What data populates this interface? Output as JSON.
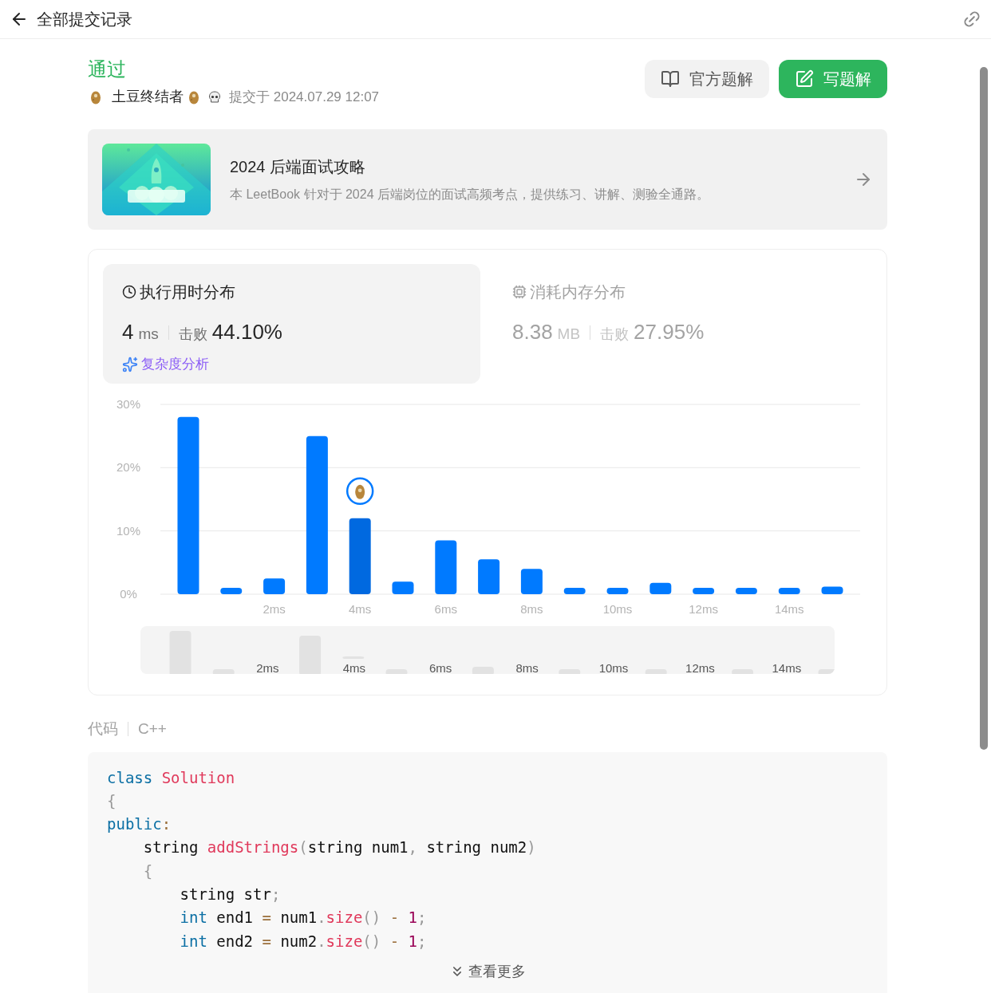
{
  "header": {
    "title": "全部提交记录"
  },
  "result": {
    "status": "通过",
    "user": "土豆终结者",
    "submitted": "提交于 2024.07.29 12:07"
  },
  "buttons": [
    {
      "label": "官方题解",
      "kind": "secondary"
    },
    {
      "label": "写题解",
      "kind": "primary"
    }
  ],
  "banner": {
    "title": "2024 后端面试攻略",
    "description": "本 LeetBook 针对于 2024 后端岗位的面试高频考点，提供练习、讲解、测验全通路。"
  },
  "stats": [
    {
      "title": "执行用时分布",
      "value": "4",
      "unit": "ms",
      "beat_label": "击败",
      "beat": "44.10%",
      "selected": true,
      "link": "复杂度分析"
    },
    {
      "title": "消耗内存分布",
      "value": "8.38",
      "unit": "MB",
      "beat_label": "击败",
      "beat": "27.95%",
      "selected": false
    }
  ],
  "chart_data": {
    "type": "bar",
    "x": [
      0,
      1,
      2,
      3,
      4,
      5,
      6,
      7,
      8,
      9,
      10,
      11,
      12,
      13,
      14,
      15
    ],
    "values": [
      28,
      1,
      2.5,
      25,
      12,
      2,
      8.5,
      5.5,
      4,
      1,
      1,
      1.8,
      1,
      1,
      1,
      1.2
    ],
    "ylim": [
      0,
      30
    ],
    "yticks": [
      {
        "value": 0,
        "label": "0%"
      },
      {
        "value": 10,
        "label": "10%"
      },
      {
        "value": 20,
        "label": "20%"
      },
      {
        "value": 30,
        "label": "30%"
      }
    ],
    "xticks": [
      {
        "value": 2,
        "label": "2ms"
      },
      {
        "value": 4,
        "label": "4ms"
      },
      {
        "value": 6,
        "label": "6ms"
      },
      {
        "value": 8,
        "label": "8ms"
      },
      {
        "value": 10,
        "label": "10ms"
      },
      {
        "value": 12,
        "label": "12ms"
      },
      {
        "value": 14,
        "label": "14ms"
      }
    ],
    "xlim": [
      -0.65,
      15.65
    ]
  },
  "histogram_bars": [
    {
      "selected": false
    },
    {
      "selected": false
    },
    {
      "selected": false
    },
    {
      "selected": false
    },
    {
      "selected": true
    },
    {
      "selected": false
    },
    {
      "selected": false
    },
    {
      "selected": false
    },
    {
      "selected": false
    },
    {
      "selected": false
    },
    {
      "selected": false
    },
    {
      "selected": false
    },
    {
      "selected": false
    },
    {
      "selected": false
    },
    {
      "selected": false
    },
    {
      "selected": false
    }
  ],
  "overview": {
    "labels": [
      "2ms",
      "4ms",
      "6ms",
      "8ms",
      "10ms",
      "12ms",
      "14ms"
    ]
  },
  "code": {
    "label": "代码",
    "language": "C++",
    "more": "查看更多",
    "lines": [
      [
        {
          "t": "class",
          "kind": "keyword"
        },
        {
          "t": " Solution",
          "kind": "function"
        }
      ],
      [
        {
          "t": "{",
          "kind": "punctuation"
        }
      ],
      [
        {
          "t": "public",
          "kind": "keyword"
        },
        {
          "t": ":",
          "kind": "operator"
        }
      ],
      [
        {
          "t": "    string ",
          "kind": "plain"
        },
        {
          "t": "addStrings",
          "kind": "function"
        },
        {
          "t": "(",
          "kind": "punctuation"
        },
        {
          "t": "string num1",
          "kind": "plain"
        },
        {
          "t": ",",
          "kind": "punctuation"
        },
        {
          "t": " string num2",
          "kind": "plain"
        },
        {
          "t": ")",
          "kind": "punctuation"
        }
      ],
      [
        {
          "t": "    {",
          "kind": "punctuation"
        }
      ],
      [
        {
          "t": "        string str",
          "kind": "plain"
        },
        {
          "t": ";",
          "kind": "punctuation"
        }
      ],
      [
        {
          "t": "        int",
          "kind": "keyword"
        },
        {
          "t": " end1 ",
          "kind": "plain"
        },
        {
          "t": "=",
          "kind": "operator"
        },
        {
          "t": " num1",
          "kind": "plain"
        },
        {
          "t": ".",
          "kind": "punctuation"
        },
        {
          "t": "size",
          "kind": "function"
        },
        {
          "t": "()",
          "kind": "punctuation"
        },
        {
          "t": " -",
          "kind": "operator"
        },
        {
          "t": " 1",
          "kind": "number"
        },
        {
          "t": ";",
          "kind": "punctuation"
        }
      ],
      [
        {
          "t": "        int",
          "kind": "keyword"
        },
        {
          "t": " end2 ",
          "kind": "plain"
        },
        {
          "t": "=",
          "kind": "operator"
        },
        {
          "t": " num2",
          "kind": "plain"
        },
        {
          "t": ".",
          "kind": "punctuation"
        },
        {
          "t": "size",
          "kind": "function"
        },
        {
          "t": "()",
          "kind": "punctuation"
        },
        {
          "t": " -",
          "kind": "operator"
        },
        {
          "t": " 1",
          "kind": "number"
        },
        {
          "t": ";",
          "kind": "punctuation"
        }
      ]
    ]
  }
}
